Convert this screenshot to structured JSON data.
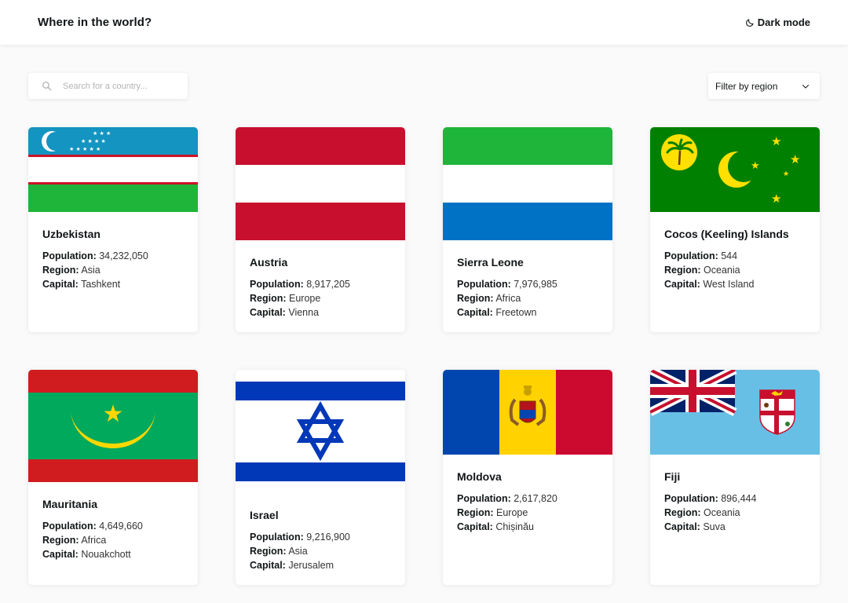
{
  "header": {
    "title": "Where in the world?",
    "mode_label": "Dark mode"
  },
  "search": {
    "placeholder": "Search for a country..."
  },
  "filter": {
    "label": "Filter by region"
  },
  "labels": {
    "population": "Population:",
    "region": "Region:",
    "capital": "Capital:"
  },
  "countries": [
    {
      "name": "Uzbekistan",
      "population": "34,232,050",
      "region": "Asia",
      "capital": "Tashkent"
    },
    {
      "name": "Austria",
      "population": "8,917,205",
      "region": "Europe",
      "capital": "Vienna"
    },
    {
      "name": "Sierra Leone",
      "population": "7,976,985",
      "region": "Africa",
      "capital": "Freetown"
    },
    {
      "name": "Cocos (Keeling) Islands",
      "population": "544",
      "region": "Oceania",
      "capital": "West Island"
    },
    {
      "name": "Mauritania",
      "population": "4,649,660",
      "region": "Africa",
      "capital": "Nouakchott"
    },
    {
      "name": "Israel",
      "population": "9,216,900",
      "region": "Asia",
      "capital": "Jerusalem"
    },
    {
      "name": "Moldova",
      "population": "2,617,820",
      "region": "Europe",
      "capital": "Chișinău"
    },
    {
      "name": "Fiji",
      "population": "896,444",
      "region": "Oceania",
      "capital": "Suva"
    }
  ]
}
